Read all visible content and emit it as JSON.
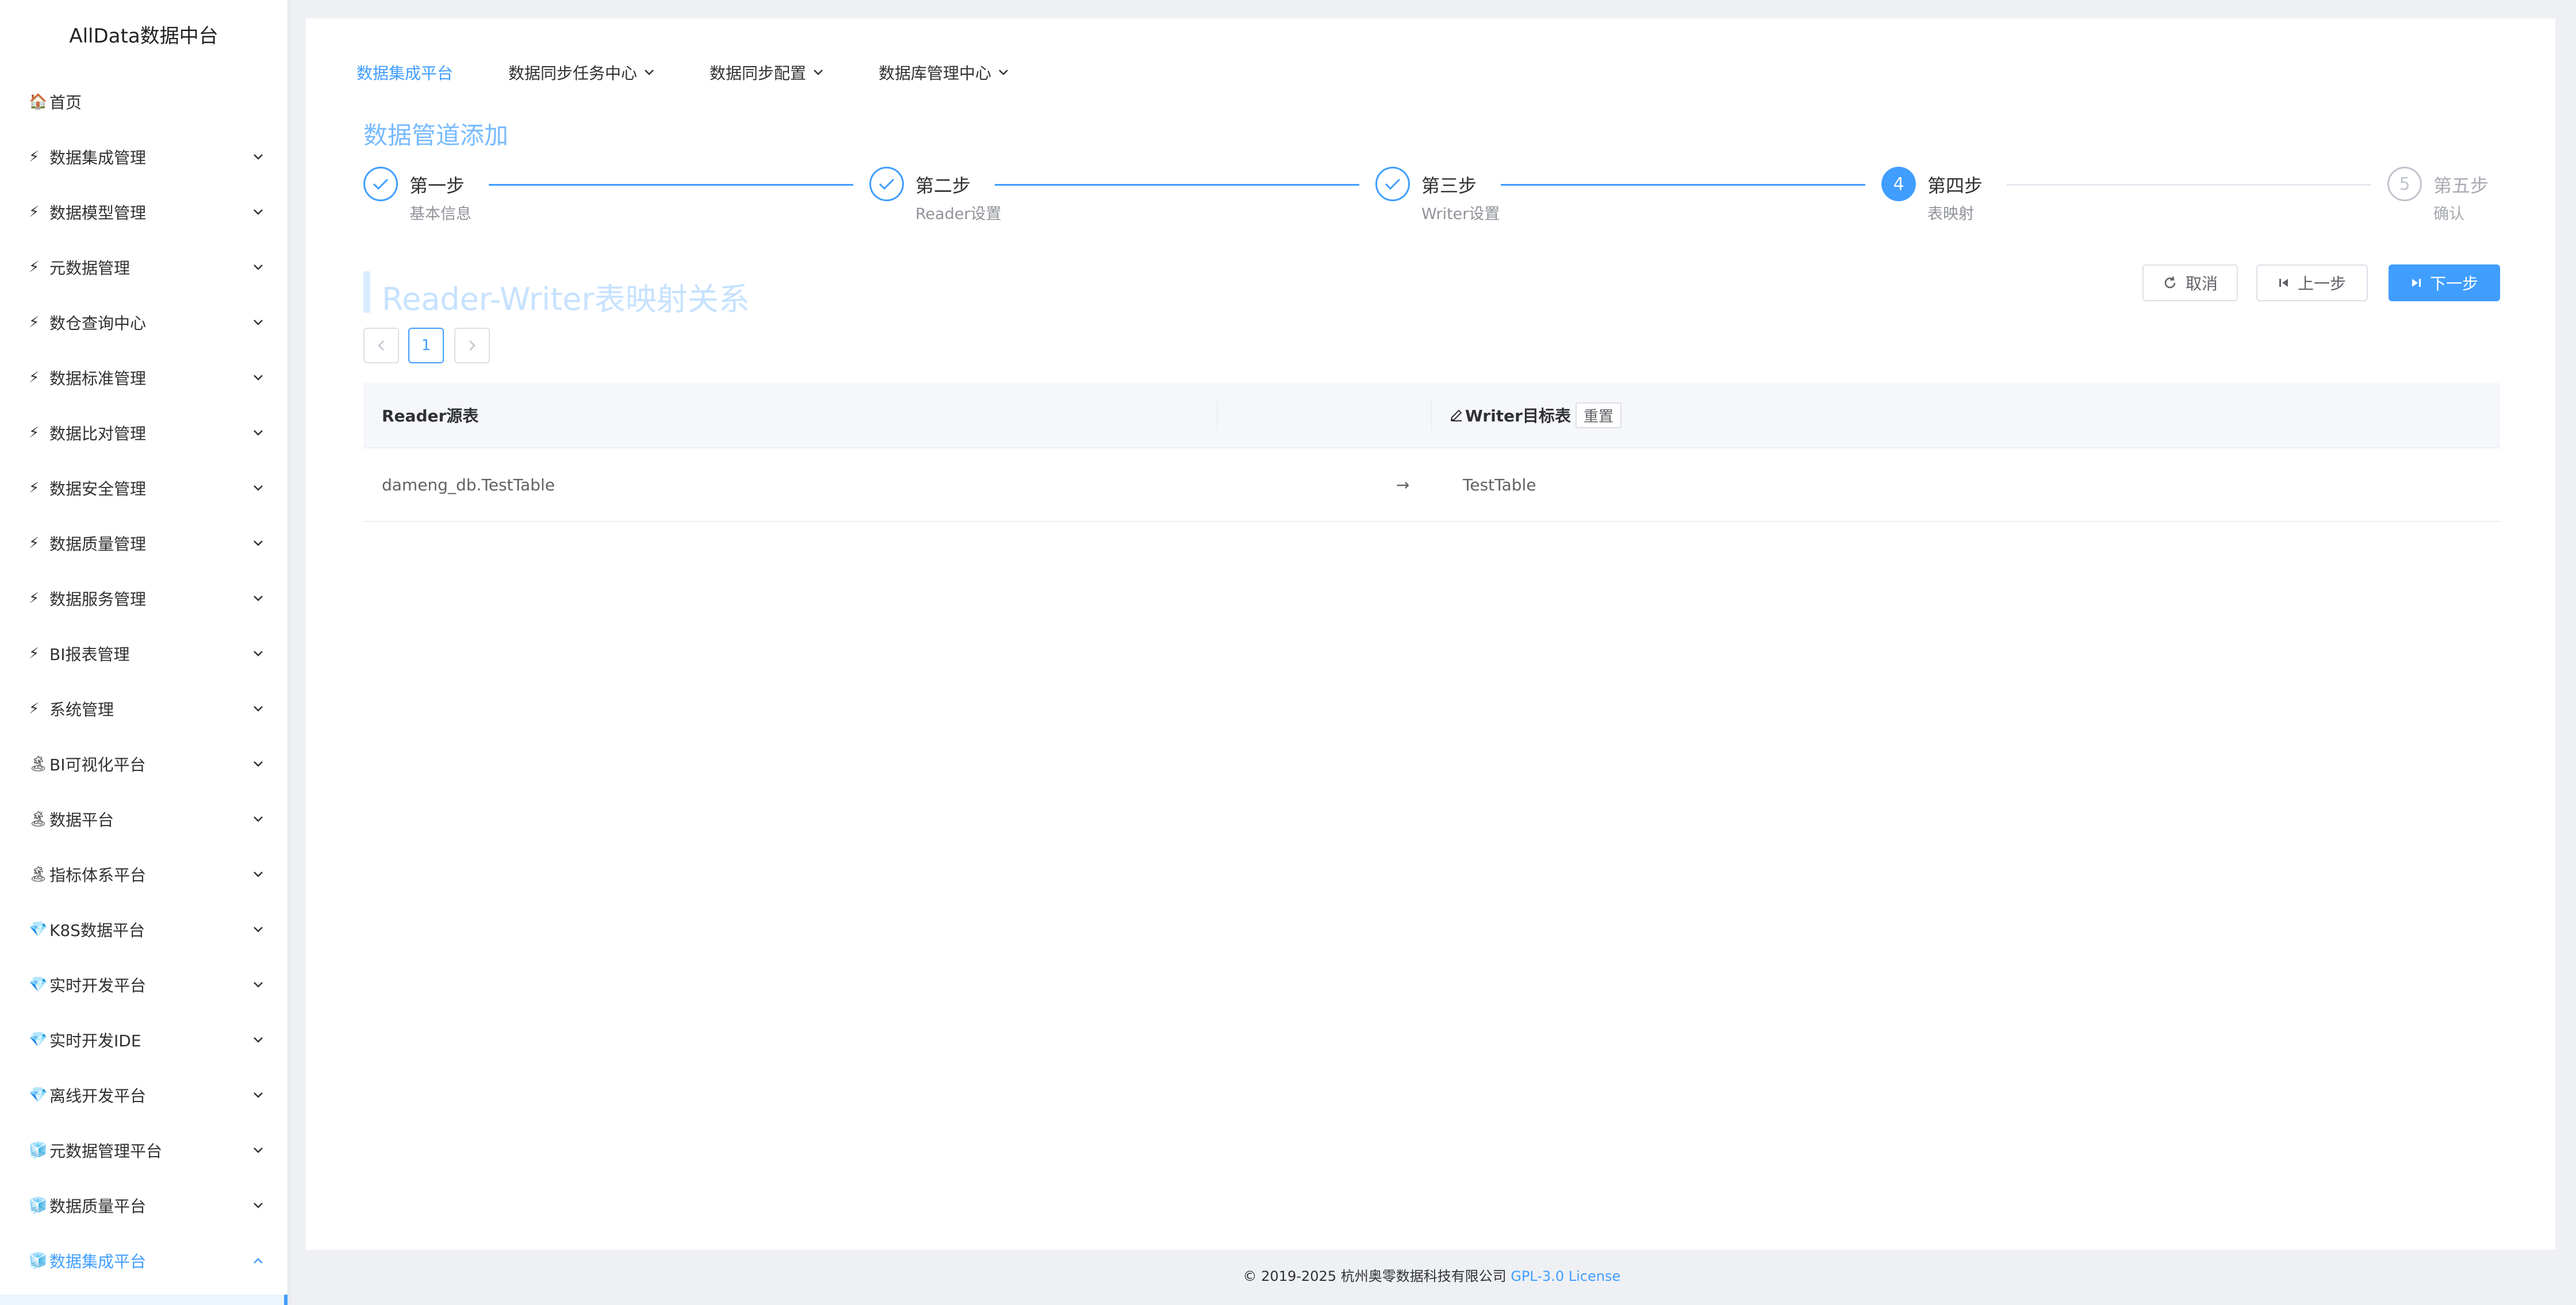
{
  "sidebar": {
    "title": "AllData数据中台",
    "items": [
      {
        "icon": "🏠",
        "label": "首页",
        "chevron": ""
      },
      {
        "icon": "⚡",
        "label": "数据集成管理",
        "chevron": "down"
      },
      {
        "icon": "⚡",
        "label": "数据模型管理",
        "chevron": "down"
      },
      {
        "icon": "⚡",
        "label": "元数据管理",
        "chevron": "down"
      },
      {
        "icon": "⚡",
        "label": "数仓查询中心",
        "chevron": "down"
      },
      {
        "icon": "⚡",
        "label": "数据标准管理",
        "chevron": "down"
      },
      {
        "icon": "⚡",
        "label": "数据比对管理",
        "chevron": "down"
      },
      {
        "icon": "⚡",
        "label": "数据安全管理",
        "chevron": "down"
      },
      {
        "icon": "⚡",
        "label": "数据质量管理",
        "chevron": "down"
      },
      {
        "icon": "⚡",
        "label": "数据服务管理",
        "chevron": "down"
      },
      {
        "icon": "⚡",
        "label": "BI报表管理",
        "chevron": "down"
      },
      {
        "icon": "⚡",
        "label": "系统管理",
        "chevron": "down"
      },
      {
        "icon": "🏝",
        "label": "BI可视化平台",
        "chevron": "down"
      },
      {
        "icon": "🏝",
        "label": "数据平台",
        "chevron": "down"
      },
      {
        "icon": "🏝",
        "label": "指标体系平台",
        "chevron": "down"
      },
      {
        "icon": "💎",
        "label": "K8S数据平台",
        "chevron": "down"
      },
      {
        "icon": "💎",
        "label": "实时开发平台",
        "chevron": "down"
      },
      {
        "icon": "💎",
        "label": "实时开发IDE",
        "chevron": "down"
      },
      {
        "icon": "💎",
        "label": "离线开发平台",
        "chevron": "down"
      },
      {
        "icon": "🧊",
        "label": "元数据管理平台",
        "chevron": "down"
      },
      {
        "icon": "🧊",
        "label": "数据质量平台",
        "chevron": "down"
      },
      {
        "icon": "🧊",
        "label": "数据集成平台",
        "chevron": "up",
        "active": true
      }
    ]
  },
  "topnav": {
    "items": [
      {
        "label": "数据集成平台",
        "active": true,
        "dropdown": false
      },
      {
        "label": "数据同步任务中心",
        "active": false,
        "dropdown": true
      },
      {
        "label": "数据同步配置",
        "active": false,
        "dropdown": true
      },
      {
        "label": "数据库管理中心",
        "active": false,
        "dropdown": true
      }
    ]
  },
  "page": {
    "title": "数据管道添加",
    "section_title": "Reader-Writer表映射关系"
  },
  "steps": [
    {
      "title": "第一步",
      "desc": "基本信息",
      "status": "done"
    },
    {
      "title": "第二步",
      "desc": "Reader设置",
      "status": "done"
    },
    {
      "title": "第三步",
      "desc": "Writer设置",
      "status": "done"
    },
    {
      "title": "第四步",
      "desc": "表映射",
      "status": "current",
      "number": "4"
    },
    {
      "title": "第五步",
      "desc": "确认",
      "status": "wait",
      "number": "5"
    }
  ],
  "buttons": {
    "cancel": "取消",
    "prev": "上一步",
    "next": "下一步"
  },
  "pagination": {
    "current_page": "1"
  },
  "table": {
    "reader_header": "Reader源表",
    "writer_header": "Writer目标表",
    "reset_label": "重置",
    "rows": [
      {
        "reader": "dameng_db.TestTable",
        "arrow": "→",
        "writer": "TestTable"
      }
    ]
  },
  "footer": {
    "copyright": "© 2019-2025 杭州奥零数据科技有限公司 ",
    "license": "GPL-3.0 License"
  },
  "colors": {
    "accent": "#409eff",
    "title_light": "#79bbff",
    "wait_gray": "#c0c4cc"
  }
}
